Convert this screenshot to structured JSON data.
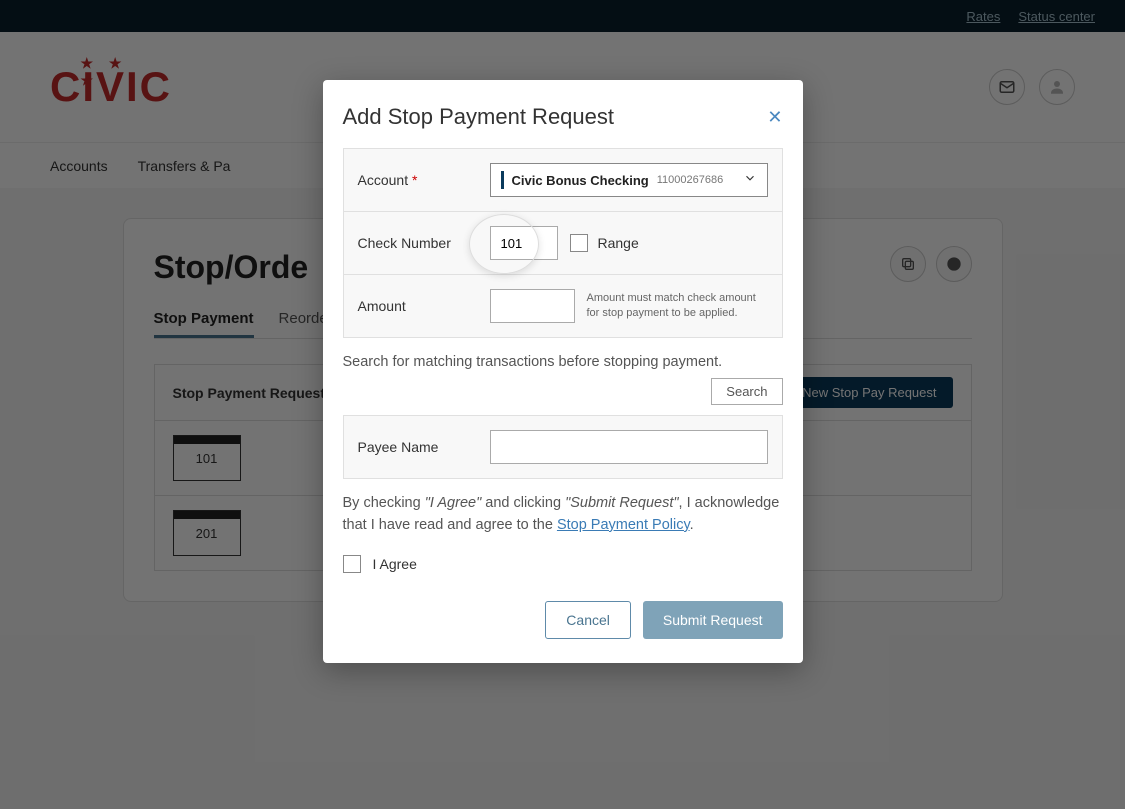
{
  "topBar": {
    "rates": "Rates",
    "statusCenter": "Status center"
  },
  "logo": "CIVIC",
  "nav": {
    "accounts": "Accounts",
    "transfers": "Transfers & Pa"
  },
  "page": {
    "title": "Stop/Orde",
    "tabStopPayment": "Stop Payment",
    "tabReorder": "Reorde"
  },
  "requests": {
    "header": "Stop Payment Requests",
    "newBtn": "New Stop Pay Request",
    "items": [
      "101",
      "201"
    ]
  },
  "modal": {
    "title": "Add Stop Payment Request",
    "accountLabel": "Account",
    "accountName": "Civic Bonus Checking",
    "accountNumber": "11000267686",
    "checkNumberLabel": "Check Number",
    "checkNumberValue": "101",
    "rangeLabel": "Range",
    "amountLabel": "Amount",
    "amountHint": "Amount must match check amount for stop payment to be applied.",
    "searchText": "Search for matching transactions before stopping payment.",
    "searchBtn": "Search",
    "payeeLabel": "Payee Name",
    "consentPart1": "By checking ",
    "consentItalic1": "\"I Agree\"",
    "consentPart2": " and clicking ",
    "consentItalic2": "\"Submit Request\"",
    "consentPart3": ", I acknowledge that I have read and agree to the ",
    "consentLink": "Stop Payment Policy",
    "agreeLabel": "I Agree",
    "cancelBtn": "Cancel",
    "submitBtn": "Submit Request"
  }
}
